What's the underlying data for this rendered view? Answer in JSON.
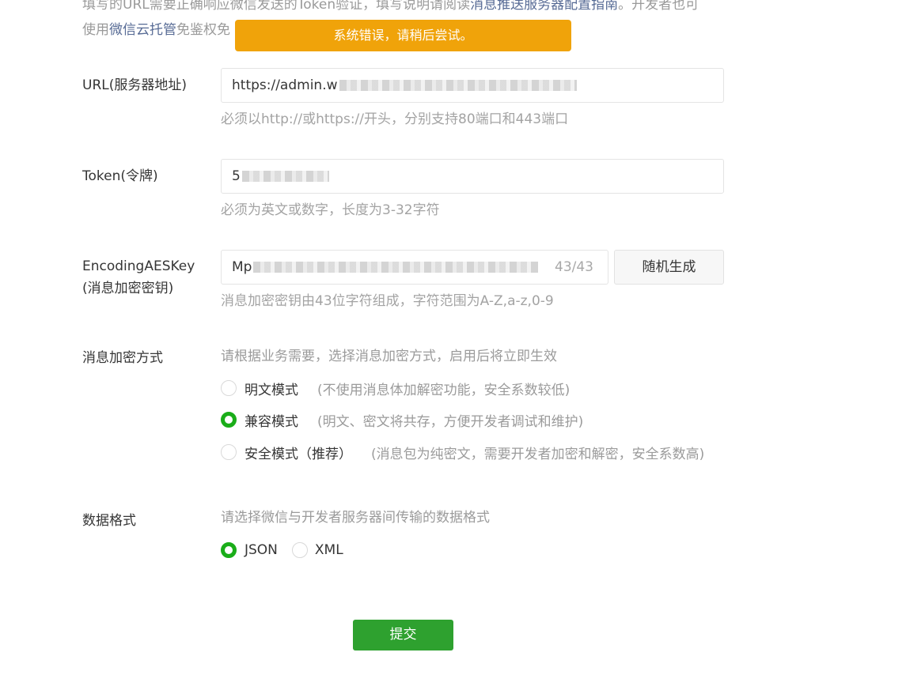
{
  "intro": {
    "line1_a": "填写的URL需要正确响应微信发送的Token验证，填写说明请阅读",
    "line1_link": "消息推送服务器配置指南",
    "line1_b": "。开发者也可",
    "line2_a": "使用",
    "line2_link": "微信云托管",
    "line2_b": "免鉴权免"
  },
  "toast": {
    "text": "系统错误，请稍后尝试。",
    "color": "#f0a30a"
  },
  "url": {
    "label": "URL(服务器地址)",
    "value": "https://admin.w",
    "hint": "必须以http://或https://开头，分别支持80端口和443端口"
  },
  "token": {
    "label": "Token(令牌)",
    "value": "5",
    "hint": "必须为英文或数字，长度为3-32字符"
  },
  "aes": {
    "label_line1": "EncodingAESKey",
    "label_line2": "(消息加密密钥)",
    "value": "Mp",
    "counter": "43/43",
    "generate_label": "随机生成",
    "hint": "消息加密密钥由43位字符组成，字符范围为A-Z,a-z,0-9"
  },
  "encrypt": {
    "label": "消息加密方式",
    "hint": "请根据业务需要，选择消息加密方式，启用后将立即生效",
    "options": [
      {
        "label": "明文模式",
        "desc": "(不使用消息体加解密功能，安全系数较低)",
        "checked": false
      },
      {
        "label": "兼容模式",
        "desc": "(明文、密文将共存，方便开发者调试和维护)",
        "checked": true
      },
      {
        "label": "安全模式（推荐）",
        "desc": "(消息包为纯密文，需要开发者加密和解密，安全系数高)",
        "checked": false
      }
    ]
  },
  "format": {
    "label": "数据格式",
    "hint": "请选择微信与开发者服务器间传输的数据格式",
    "options": [
      {
        "label": "JSON",
        "checked": true
      },
      {
        "label": "XML",
        "checked": false
      }
    ]
  },
  "submit": {
    "label": "提交",
    "color": "#2ea12f"
  },
  "colors": {
    "accent_green": "#1aad19",
    "link": "#576b95"
  }
}
